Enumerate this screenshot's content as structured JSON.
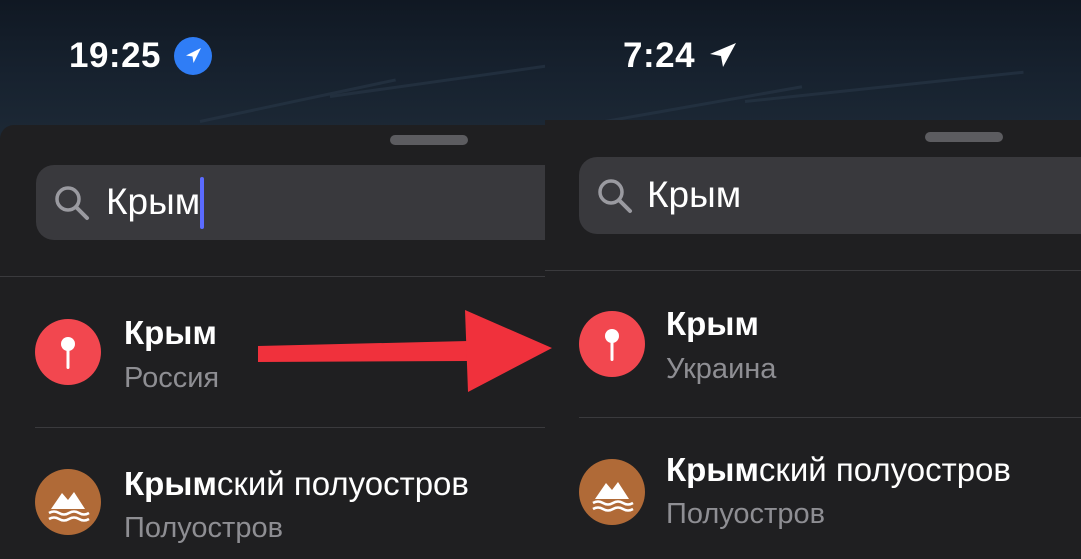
{
  "before": {
    "status_time": "19:25",
    "search_query": "Крым",
    "results": [
      {
        "title_bold": "Крым",
        "title_rest": "",
        "subtitle": "Россия",
        "icon": "map-pin-icon"
      },
      {
        "title_bold": "Крым",
        "title_rest": "ский полуостров",
        "subtitle": "Полуостров",
        "icon": "mountain-water-icon"
      }
    ]
  },
  "after": {
    "status_time": "7:24",
    "search_query": "Крым",
    "results": [
      {
        "title_bold": "Крым",
        "title_rest": "",
        "subtitle": "Украина",
        "icon": "map-pin-icon"
      },
      {
        "title_bold": "Крым",
        "title_rest": "ский полуостров",
        "subtitle": "Полуостров",
        "icon": "mountain-water-icon"
      }
    ]
  },
  "colors": {
    "pin_background": "#f2474f",
    "peninsula_background": "#b06a37",
    "arrow": "#f0313c",
    "location_badge": "#2f7df6",
    "caret": "#5b6bff"
  }
}
